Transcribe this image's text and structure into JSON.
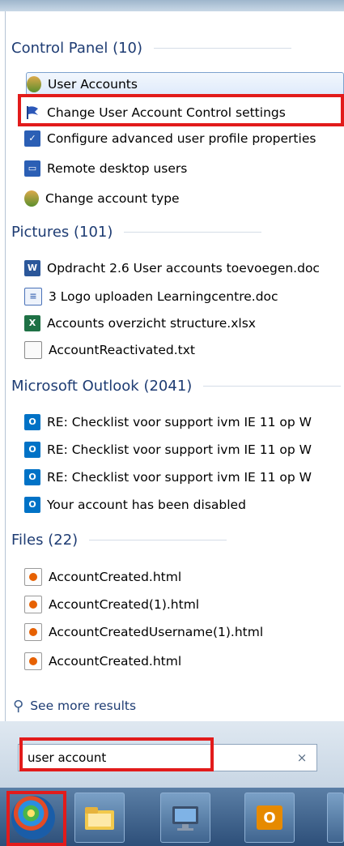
{
  "sections": {
    "control_panel": "Control Panel (10)",
    "pictures": "Pictures (101)",
    "microsoft_outlook": "Microsoft Outlook (2041)",
    "files": "Files (22)"
  },
  "control_panel_items": [
    {
      "label": "User Accounts",
      "icon": "user-accounts-icon"
    },
    {
      "label": "Change User Account Control settings",
      "icon": "flag-icon"
    },
    {
      "label": "Configure advanced user profile properties",
      "icon": "control-panel-icon"
    },
    {
      "label": "Remote desktop users",
      "icon": "remote-desktop-icon"
    },
    {
      "label": "Change account type",
      "icon": "user-accounts-icon"
    }
  ],
  "pictures_items": [
    {
      "label": "Opdracht 2.6 User accounts toevoegen.doc",
      "icon": "word-icon"
    },
    {
      "label": "3 Logo uploaden Learningcentre.doc",
      "icon": "word-doc-icon"
    },
    {
      "label": "Accounts overzicht structure.xlsx",
      "icon": "excel-icon"
    },
    {
      "label": "AccountReactivated.txt",
      "icon": "text-file-icon"
    }
  ],
  "outlook_items": [
    {
      "label": "RE: Checklist voor support ivm IE 11 op W",
      "icon": "outlook-icon"
    },
    {
      "label": "RE: Checklist voor support ivm IE 11 op W",
      "icon": "outlook-icon"
    },
    {
      "label": "RE: Checklist voor support ivm IE 11 op W",
      "icon": "outlook-icon"
    },
    {
      "label": "Your account has been disabled",
      "icon": "outlook-icon"
    }
  ],
  "files_items": [
    {
      "label": "AccountCreated.html",
      "icon": "html-file-icon"
    },
    {
      "label": "AccountCreated(1).html",
      "icon": "html-file-icon"
    },
    {
      "label": "AccountCreatedUsername(1).html",
      "icon": "html-file-icon"
    },
    {
      "label": "AccountCreated.html",
      "icon": "html-file-icon"
    }
  ],
  "see_more": "See more results",
  "search": {
    "value": "user account",
    "clear": "×"
  },
  "taskbar": {
    "items": [
      "start-orb",
      "file-explorer-icon",
      "remote-desktop-icon",
      "outlook-icon"
    ]
  },
  "colors": {
    "accent": "#1e3c73",
    "highlight": "#e21b1b",
    "selection": "#dfeafb"
  }
}
